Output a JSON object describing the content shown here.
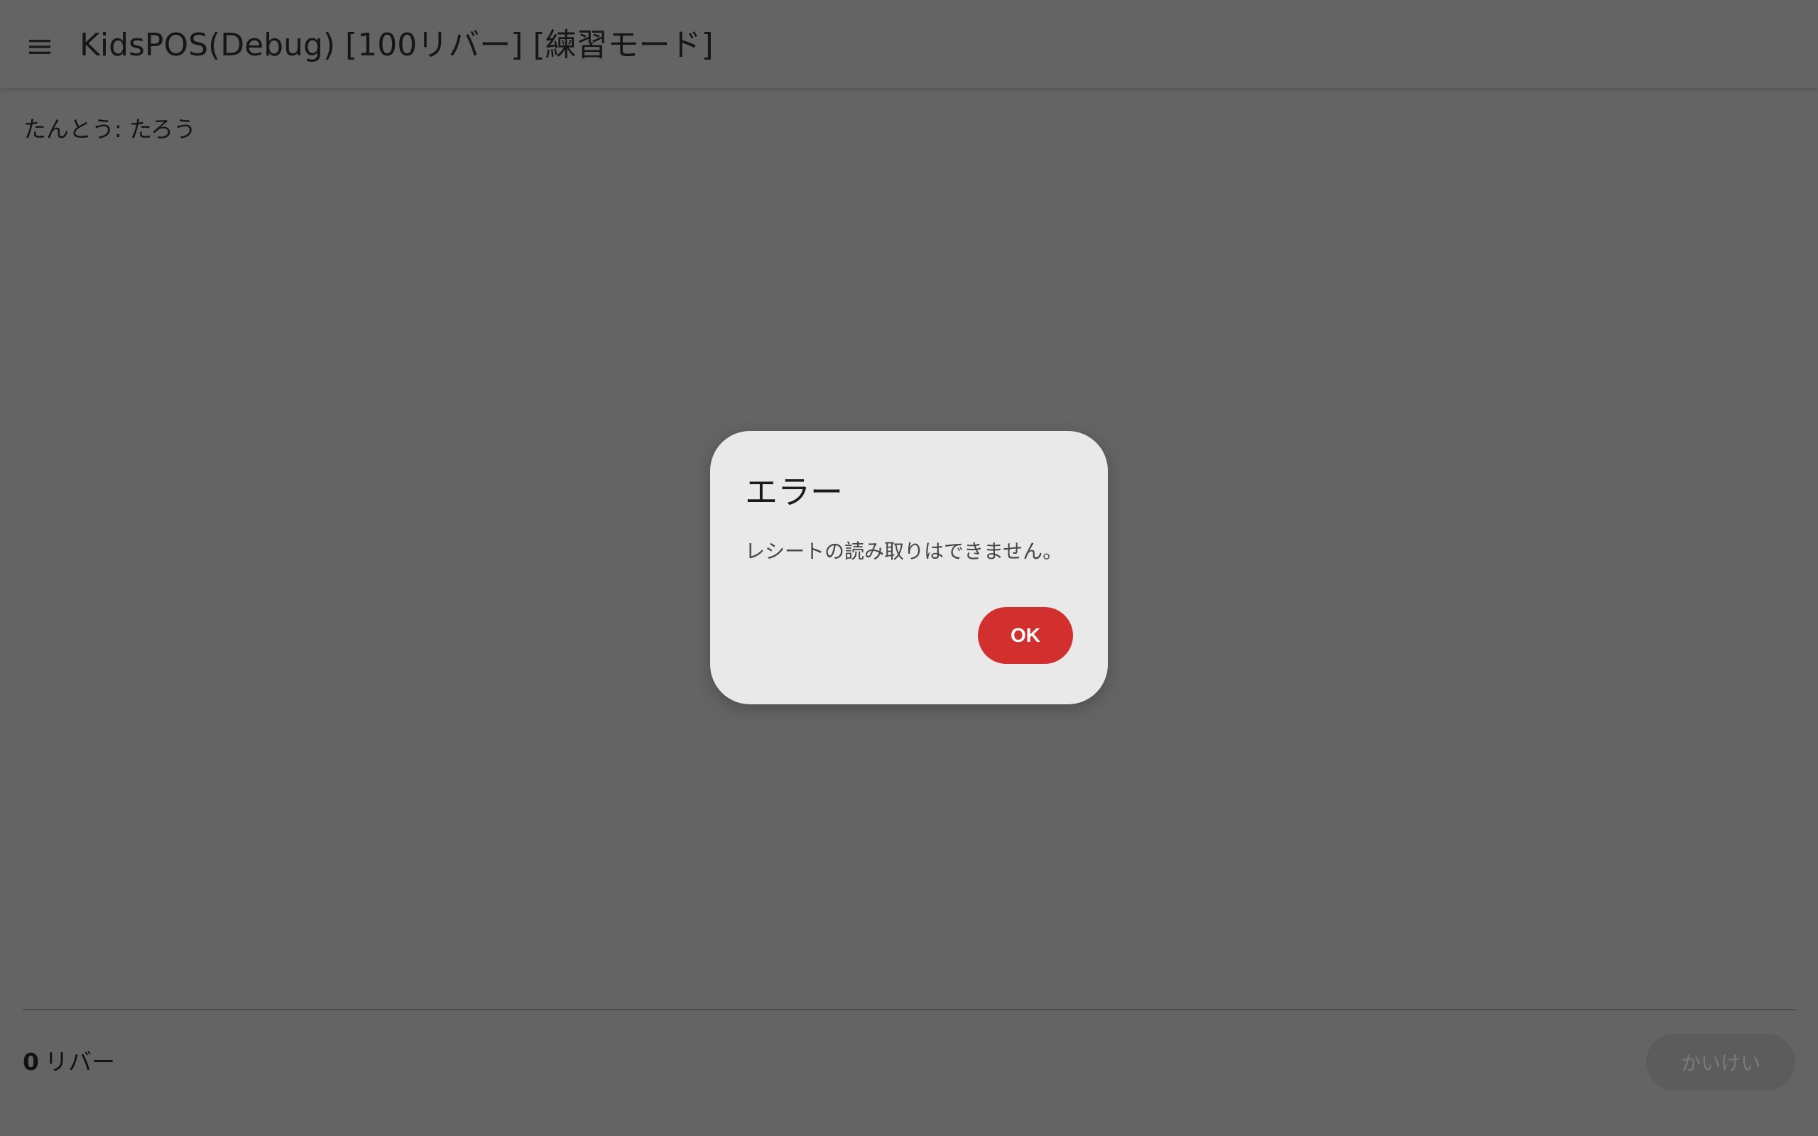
{
  "header": {
    "title": "KidsPOS(Debug) [100リバー] [練習モード]",
    "menu_icon": "hamburger-menu-icon"
  },
  "main": {
    "operator_text": "たんとう: たろう"
  },
  "footer": {
    "total_amount": "0",
    "total_unit": "リバー",
    "checkout_label": "かいけい",
    "checkout_enabled": false
  },
  "dialog": {
    "title": "エラー",
    "message": "レシートの読み取りはできません。",
    "ok_label": "OK"
  },
  "colors": {
    "scrim_background": "#646464",
    "dialog_background": "#e9e9e9",
    "ok_button": "#d32f2f",
    "checkout_disabled": "#5c5c5c"
  }
}
